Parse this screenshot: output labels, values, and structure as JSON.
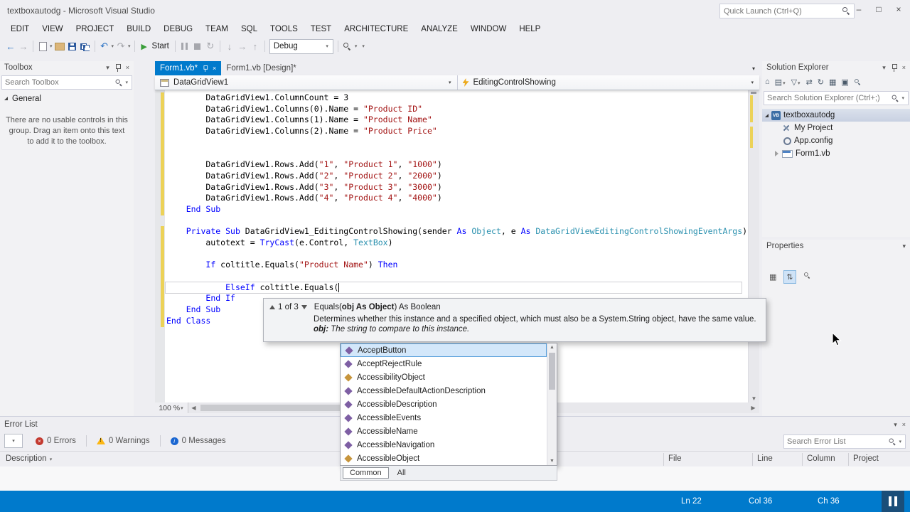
{
  "colors": {
    "accent": "#007acc",
    "keyword": "#0000ff",
    "string": "#a31515",
    "type": "#2b91af",
    "change_bar": "#ecd258"
  },
  "window": {
    "title": "textboxautodg - Microsoft Visual Studio",
    "quick_launch_placeholder": "Quick Launch (Ctrl+Q)"
  },
  "menubar": {
    "items": [
      "EDIT",
      "VIEW",
      "PROJECT",
      "BUILD",
      "DEBUG",
      "TEAM",
      "SQL",
      "TOOLS",
      "TEST",
      "ARCHITECTURE",
      "ANALYZE",
      "WINDOW",
      "HELP"
    ]
  },
  "toolbar": {
    "start_label": "Start",
    "solution_config": "Debug"
  },
  "toolbox": {
    "title": "Toolbox",
    "search_placeholder": "Search Toolbox",
    "section_label": "General",
    "empty_text": "There are no usable controls in this group. Drag an item onto this text to add it to the toolbox."
  },
  "editor": {
    "tabs": [
      {
        "label": "Form1.vb*"
      },
      {
        "label": "Form1.vb [Design]*"
      }
    ],
    "nav_object": "DataGridView1",
    "nav_event": "EditingControlShowing",
    "zoom_level": "100 %",
    "code_lines": [
      [
        {
          "c": "n",
          "t": "        DataGridView1.ColumnCount = 3"
        }
      ],
      [
        {
          "c": "n",
          "t": "        DataGridView1.Columns(0).Name = "
        },
        {
          "c": "s",
          "t": "\"Product ID\""
        }
      ],
      [
        {
          "c": "n",
          "t": "        DataGridView1.Columns(1).Name = "
        },
        {
          "c": "s",
          "t": "\"Product Name\""
        }
      ],
      [
        {
          "c": "n",
          "t": "        DataGridView1.Columns(2).Name = "
        },
        {
          "c": "s",
          "t": "\"Product Price\""
        }
      ],
      [],
      [],
      [
        {
          "c": "n",
          "t": "        DataGridView1.Rows.Add("
        },
        {
          "c": "s",
          "t": "\"1\""
        },
        {
          "c": "n",
          "t": ", "
        },
        {
          "c": "s",
          "t": "\"Product 1\""
        },
        {
          "c": "n",
          "t": ", "
        },
        {
          "c": "s",
          "t": "\"1000\""
        },
        {
          "c": "n",
          "t": ")"
        }
      ],
      [
        {
          "c": "n",
          "t": "        DataGridView1.Rows.Add("
        },
        {
          "c": "s",
          "t": "\"2\""
        },
        {
          "c": "n",
          "t": ", "
        },
        {
          "c": "s",
          "t": "\"Product 2\""
        },
        {
          "c": "n",
          "t": ", "
        },
        {
          "c": "s",
          "t": "\"2000\""
        },
        {
          "c": "n",
          "t": ")"
        }
      ],
      [
        {
          "c": "n",
          "t": "        DataGridView1.Rows.Add("
        },
        {
          "c": "s",
          "t": "\"3\""
        },
        {
          "c": "n",
          "t": ", "
        },
        {
          "c": "s",
          "t": "\"Product 3\""
        },
        {
          "c": "n",
          "t": ", "
        },
        {
          "c": "s",
          "t": "\"3000\""
        },
        {
          "c": "n",
          "t": ")"
        }
      ],
      [
        {
          "c": "n",
          "t": "        DataGridView1.Rows.Add("
        },
        {
          "c": "s",
          "t": "\"4\""
        },
        {
          "c": "n",
          "t": ", "
        },
        {
          "c": "s",
          "t": "\"Product 4\""
        },
        {
          "c": "n",
          "t": ", "
        },
        {
          "c": "s",
          "t": "\"4000\""
        },
        {
          "c": "n",
          "t": ")"
        }
      ],
      [
        {
          "c": "n",
          "t": "    "
        },
        {
          "c": "k",
          "t": "End Sub"
        }
      ],
      [],
      [
        {
          "c": "n",
          "t": "    "
        },
        {
          "c": "k",
          "t": "Private Sub"
        },
        {
          "c": "n",
          "t": " DataGridView1_EditingControlShowing(sender "
        },
        {
          "c": "k",
          "t": "As"
        },
        {
          "c": "n",
          "t": " "
        },
        {
          "c": "t",
          "t": "Object"
        },
        {
          "c": "n",
          "t": ", e "
        },
        {
          "c": "k",
          "t": "As"
        },
        {
          "c": "n",
          "t": " "
        },
        {
          "c": "t",
          "t": "DataGridViewEditingControlShowingEventArgs"
        },
        {
          "c": "n",
          "t": ")"
        }
      ],
      [
        {
          "c": "n",
          "t": "        autotext = "
        },
        {
          "c": "k",
          "t": "TryCast"
        },
        {
          "c": "n",
          "t": "(e.Control, "
        },
        {
          "c": "t",
          "t": "TextBox"
        },
        {
          "c": "n",
          "t": ")"
        }
      ],
      [],
      [
        {
          "c": "n",
          "t": "        "
        },
        {
          "c": "k",
          "t": "If"
        },
        {
          "c": "n",
          "t": " coltitle.Equals("
        },
        {
          "c": "s",
          "t": "\"Product Name\""
        },
        {
          "c": "n",
          "t": ") "
        },
        {
          "c": "k",
          "t": "Then"
        }
      ],
      [],
      [
        {
          "c": "n",
          "t": "            "
        },
        {
          "c": "k",
          "t": "ElseIf"
        },
        {
          "c": "n",
          "t": " coltitle.Equals("
        }
      ],
      [
        {
          "c": "n",
          "t": "        "
        },
        {
          "c": "k",
          "t": "End If"
        }
      ],
      [
        {
          "c": "n",
          "t": "    "
        },
        {
          "c": "k",
          "t": "End Sub"
        }
      ],
      [
        {
          "c": "k",
          "t": "End Class"
        }
      ]
    ]
  },
  "intellisense": {
    "signature": {
      "pager": "1 of 3",
      "prefix": "Equals(",
      "current_param": "obj As Object",
      "suffix": ") As Boolean",
      "description": "Determines whether this instance and a specified object, which must also be a System.String object, have the same value.",
      "param_label": "obj:",
      "param_doc": "The string to compare to this instance."
    },
    "completion": {
      "items": [
        {
          "label": "AcceptButton",
          "icon": "method-icon",
          "selected": true
        },
        {
          "label": "AcceptRejectRule",
          "icon": "method-icon",
          "selected": false
        },
        {
          "label": "AccessibilityObject",
          "icon": "class-icon",
          "selected": false
        },
        {
          "label": "AccessibleDefaultActionDescription",
          "icon": "method-icon",
          "selected": false
        },
        {
          "label": "AccessibleDescription",
          "icon": "method-icon",
          "selected": false
        },
        {
          "label": "AccessibleEvents",
          "icon": "method-icon",
          "selected": false
        },
        {
          "label": "AccessibleName",
          "icon": "method-icon",
          "selected": false
        },
        {
          "label": "AccessibleNavigation",
          "icon": "method-icon",
          "selected": false
        },
        {
          "label": "AccessibleObject",
          "icon": "class-icon",
          "selected": false
        }
      ],
      "tabs": [
        {
          "label": "Common",
          "active": true
        },
        {
          "label": "All",
          "active": false
        }
      ]
    }
  },
  "solution_explorer": {
    "title": "Solution Explorer",
    "search_placeholder": "Search Solution Explorer (Ctrl+;)",
    "tree": [
      {
        "label": "textboxautodg",
        "icon": "vb-project",
        "indent": 0,
        "expander": "open",
        "selected": true
      },
      {
        "label": "My Project",
        "icon": "my-project",
        "indent": 1,
        "expander": "none",
        "selected": false
      },
      {
        "label": "App.config",
        "icon": "config",
        "indent": 1,
        "expander": "none",
        "selected": false
      },
      {
        "label": "Form1.vb",
        "icon": "form",
        "indent": 1,
        "expander": "closed",
        "selected": false
      }
    ]
  },
  "properties_panel": {
    "title": "Properties"
  },
  "error_list": {
    "title": "Error List",
    "errors": "0 Errors",
    "warnings": "0 Warnings",
    "messages": "0 Messages",
    "search_placeholder": "Search Error List",
    "columns": [
      "Description",
      "File",
      "Line",
      "Column",
      "Project"
    ]
  },
  "statusbar": {
    "line": "Ln 22",
    "column": "Col 36",
    "char": "Ch 36"
  }
}
